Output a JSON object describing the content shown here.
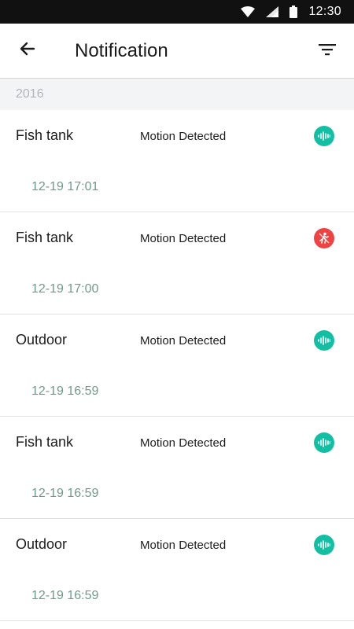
{
  "status_bar": {
    "time": "12:30"
  },
  "header": {
    "title": "Notification"
  },
  "section": {
    "year": "2016"
  },
  "notifications": [
    {
      "device": "Fish tank",
      "event": "Motion Detected",
      "time": "12-19 17:01",
      "icon": "sound-wave-icon",
      "color": "#13bfa3"
    },
    {
      "device": "Fish tank",
      "event": "Motion Detected",
      "time": "12-19 17:00",
      "icon": "person-walking-icon",
      "color": "#ee4343"
    },
    {
      "device": "Outdoor",
      "event": "Motion Detected",
      "time": "12-19 16:59",
      "icon": "sound-wave-icon",
      "color": "#13bfa3"
    },
    {
      "device": "Fish tank",
      "event": "Motion Detected",
      "time": "12-19 16:59",
      "icon": "sound-wave-icon",
      "color": "#13bfa3"
    },
    {
      "device": "Outdoor",
      "event": "Motion Detected",
      "time": "12-19 16:59",
      "icon": "sound-wave-icon",
      "color": "#13bfa3"
    }
  ]
}
